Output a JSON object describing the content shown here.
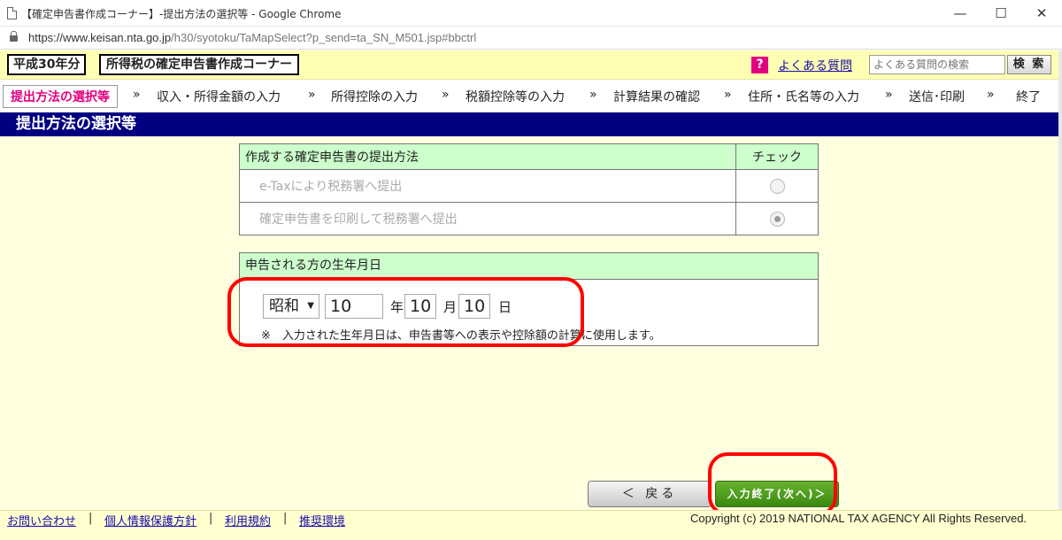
{
  "browser": {
    "window_title": "【確定申告書作成コーナー】-提出方法の選択等 - Google Chrome",
    "url_host": "https://www.keisan.nta.go.jp",
    "url_path": "/h30/syotoku/TaMapSelect?p_send=ta_SN_M501.jsp#bbctrl",
    "minimize": "—",
    "maximize": "☐",
    "close": "✕"
  },
  "header": {
    "year": "平成30年分",
    "corner": "所得税の確定申告書作成コーナー",
    "help_icon": "?",
    "faq_link": "よくある質問",
    "faq_search_placeholder": "よくある質問の検索",
    "search_button": "検 索"
  },
  "steps": [
    "提出方法の選択等",
    "収入・所得金額の入力",
    "所得控除の入力",
    "税額控除等の入力",
    "計算結果の確認",
    "住所・氏名等の入力",
    "送信･印刷",
    "終了"
  ],
  "step_separator": "»",
  "section_title": "提出方法の選択等",
  "submission": {
    "header_method": "作成する確定申告書の提出方法",
    "header_check": "チェック",
    "options": [
      {
        "label": "e-Taxにより税務署へ提出",
        "checked": false
      },
      {
        "label": "確定申告書を印刷して税務署へ提出",
        "checked": true
      }
    ]
  },
  "birthdate": {
    "header": "申告される方の生年月日",
    "era": "昭和",
    "year": "10",
    "year_unit": "年",
    "month": "10",
    "month_unit": "月",
    "day": "10",
    "day_unit": "日",
    "note": "※　入力された生年月日は、申告書等への表示や控除額の計算に使用します。"
  },
  "buttons": {
    "back": "＜ 戻る",
    "next": "入力終了(次へ)＞"
  },
  "footer": {
    "links": [
      "お問い合わせ",
      "個人情報保護方針",
      "利用規約",
      "推奨環境"
    ],
    "copyright": "Copyright (c) 2019 NATIONAL TAX AGENCY All Rights Reserved."
  },
  "colors": {
    "header_bg": "#ffffb3",
    "section_bg": "#000080",
    "table_head_bg": "#ccffcc",
    "main_bg": "#ffffe0",
    "active_step": "#e3007f",
    "next_button": "#3a8a12",
    "highlight": "#ff0000"
  }
}
